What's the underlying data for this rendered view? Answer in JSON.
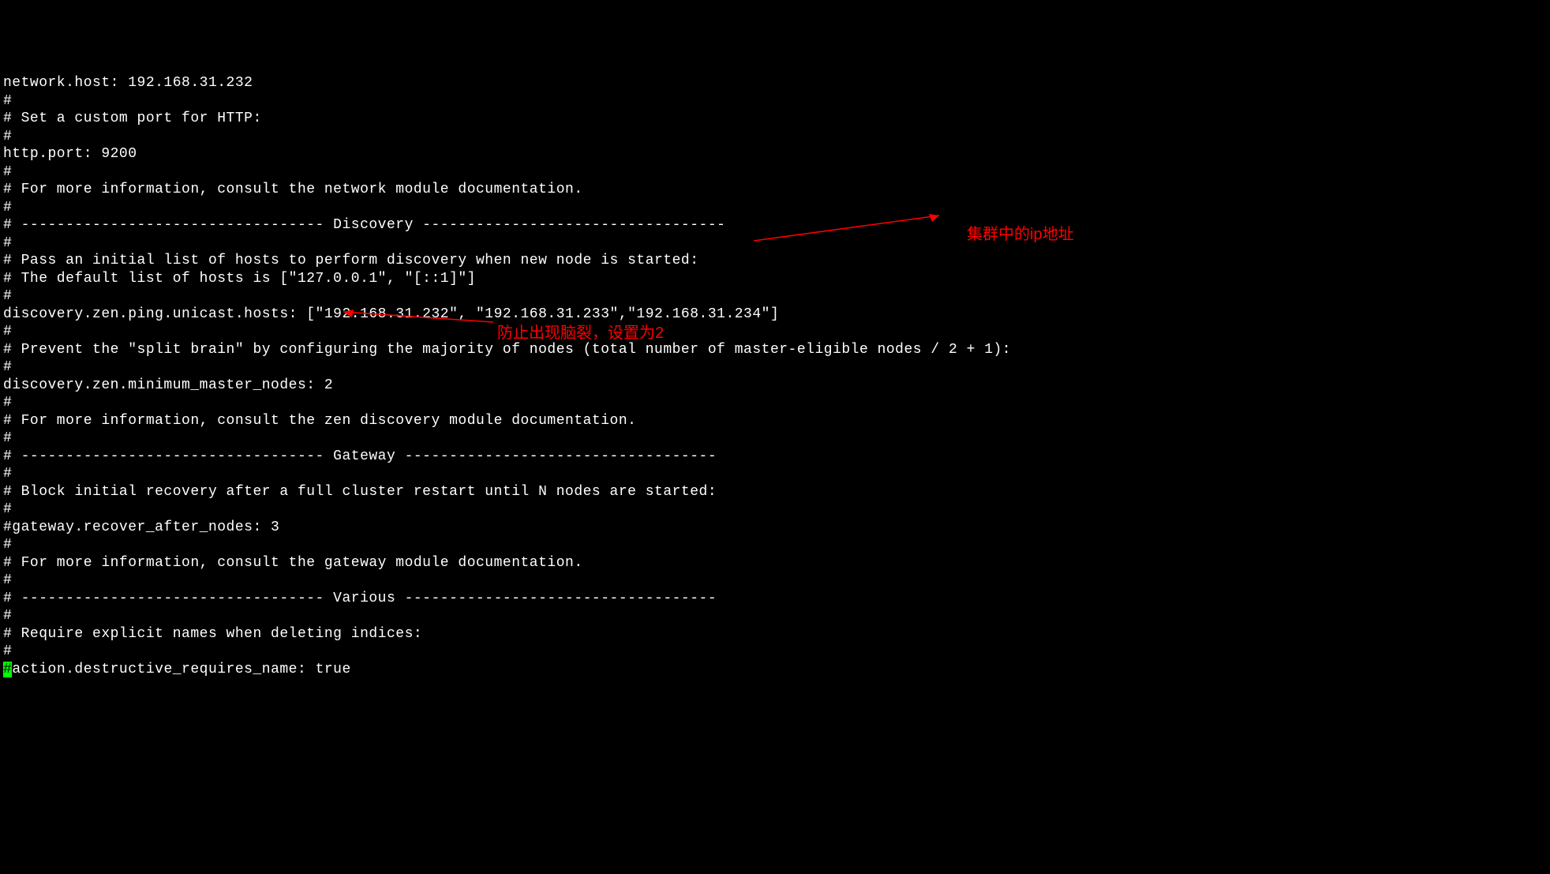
{
  "terminal": {
    "lines": [
      "network.host: 192.168.31.232",
      "#",
      "# Set a custom port for HTTP:",
      "#",
      "http.port: 9200",
      "#",
      "# For more information, consult the network module documentation.",
      "#",
      "# ---------------------------------- Discovery ----------------------------------",
      "#",
      "# Pass an initial list of hosts to perform discovery when new node is started:",
      "# The default list of hosts is [\"127.0.0.1\", \"[::1]\"]",
      "#",
      "discovery.zen.ping.unicast.hosts: [\"192.168.31.232\", \"192.168.31.233\",\"192.168.31.234\"]",
      "#",
      "# Prevent the \"split brain\" by configuring the majority of nodes (total number of master-eligible nodes / 2 + 1):",
      "#",
      "discovery.zen.minimum_master_nodes: 2",
      "#",
      "# For more information, consult the zen discovery module documentation.",
      "#",
      "# ---------------------------------- Gateway -----------------------------------",
      "#",
      "# Block initial recovery after a full cluster restart until N nodes are started:",
      "#",
      "#gateway.recover_after_nodes: 3",
      "#",
      "# For more information, consult the gateway module documentation.",
      "#",
      "# ---------------------------------- Various -----------------------------------",
      "#",
      "# Require explicit names when deleting indices:",
      "#"
    ],
    "last_line_cursor": "#",
    "last_line_rest": "action.destructive_requires_name: true"
  },
  "annotations": {
    "cluster_ip": "集群中的ip地址",
    "split_brain": "防止出现脑裂，设置为2"
  }
}
